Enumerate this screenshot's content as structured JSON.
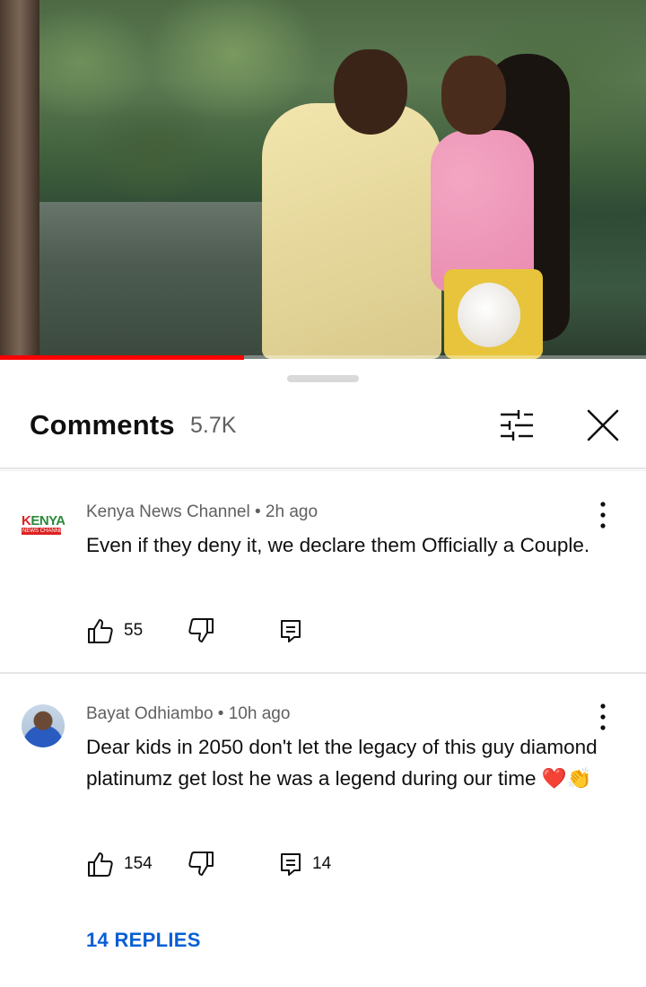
{
  "video": {
    "progress_fraction": 0.378,
    "progress_color": "#ff0000"
  },
  "comments_panel": {
    "title": "Comments",
    "count": "5.7K",
    "filter_icon": "sliders-icon",
    "close_icon": "close-icon"
  },
  "comments": [
    {
      "author": "Kenya News Channel",
      "time": "2h ago",
      "meta": "Kenya News Channel • 2h ago",
      "avatar_text_top": "KENYA",
      "avatar_text_bottom": "NEWS CHANNEL",
      "text": "Even if they deny it, we declare them Officially a Couple.",
      "likes": "55",
      "replies_count": ""
    },
    {
      "author": "Bayat Odhiambo",
      "time": "10h ago",
      "meta": "Bayat Odhiambo • 10h ago",
      "text": "Dear kids in 2050 don't let the legacy of this guy diamond platinumz get lost he was a legend during our time ❤️👏",
      "likes": "154",
      "replies_count": "14",
      "replies_link": "14 REPLIES"
    }
  ],
  "colors": {
    "accent_link": "#065fd4",
    "secondary_text": "#606060",
    "divider": "#e5e5e5"
  }
}
